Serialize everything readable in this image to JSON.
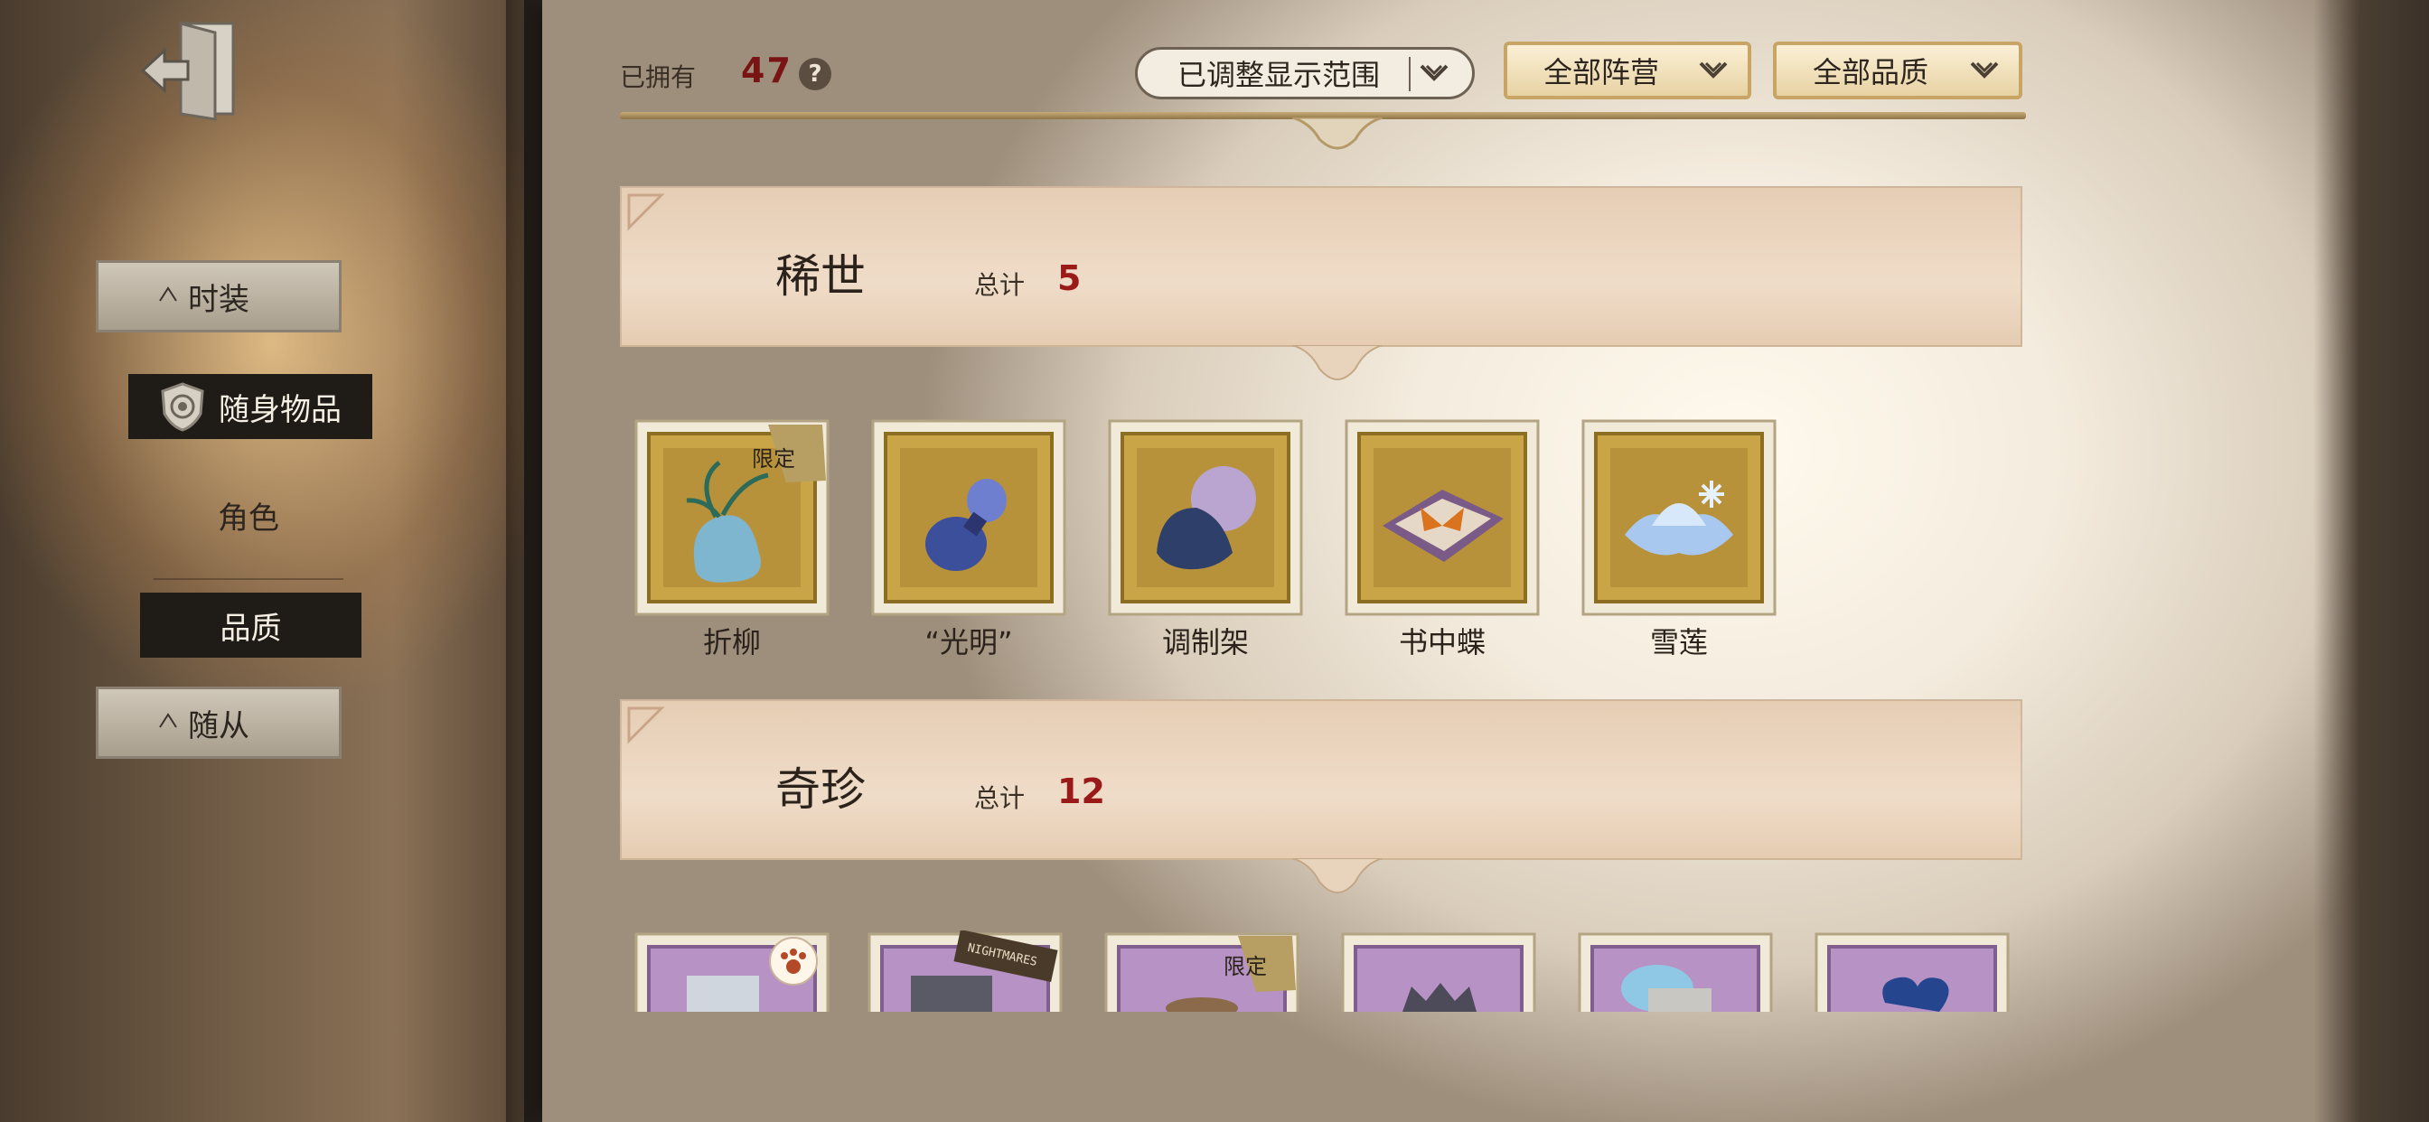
{
  "sidebar": {
    "exit_icon": "exit-door-icon",
    "items": [
      {
        "label": "时装"
      },
      {
        "label": "随身物品",
        "icon": "shield-emblem-icon"
      },
      {
        "label": "角色"
      },
      {
        "label": "品质"
      },
      {
        "label": "随从"
      }
    ]
  },
  "header": {
    "owned_label": "已拥有",
    "owned_count": "47",
    "help_icon": "?",
    "range_dropdown": "已调整显示范围",
    "faction_dropdown": "全部阵营",
    "quality_dropdown": "全部品质"
  },
  "sections": [
    {
      "title": "稀世",
      "total_label": "总计",
      "total": "5",
      "items": [
        {
          "name": "折柳",
          "badge": "限定",
          "tier": "gold",
          "icon": "willow-vase-icon"
        },
        {
          "name": "“光明”",
          "tier": "gold",
          "icon": "lantern-bottle-icon"
        },
        {
          "name": "调制架",
          "tier": "gold",
          "icon": "crystal-stand-icon"
        },
        {
          "name": "书中蝶",
          "tier": "gold",
          "icon": "butterfly-book-icon"
        },
        {
          "name": "雪莲",
          "tier": "gold",
          "icon": "snow-lotus-icon"
        }
      ]
    },
    {
      "title": "奇珍",
      "total_label": "总计",
      "total": "12",
      "items": [
        {
          "tier": "purple",
          "icon": "paw-sticker-icon"
        },
        {
          "tier": "purple",
          "icon": "nightmares-tag-icon",
          "tag": "NIGHTMARES"
        },
        {
          "tier": "purple",
          "badge": "限定",
          "icon": "trinket-icon"
        },
        {
          "tier": "purple",
          "icon": "crown-icon"
        },
        {
          "tier": "purple",
          "icon": "crystal-icon"
        },
        {
          "tier": "purple",
          "icon": "heart-icon"
        }
      ]
    }
  ],
  "colors": {
    "count_red": "#7a1414",
    "gold_frame": "#c9a548",
    "purple_frame": "#b792c4"
  }
}
